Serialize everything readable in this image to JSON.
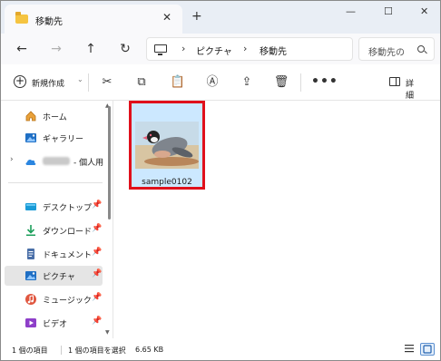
{
  "window": {
    "tab_title": "移動先",
    "close_tab_glyph": "✕",
    "new_tab_glyph": "+",
    "minimize_glyph": "—",
    "maximize_glyph": "☐",
    "close_glyph": "✕"
  },
  "nav": {
    "back_glyph": "←",
    "forward_glyph": "→",
    "up_glyph": "↑",
    "refresh_glyph": "↻",
    "breadcrumb": [
      "ピクチャ",
      "移動先"
    ],
    "crumb_sep": "›",
    "search_placeholder": "移動先の"
  },
  "toolbar": {
    "new_label": "新規作成",
    "new_chevron": "⌄",
    "cut_glyph": "✂",
    "copy_glyph": "⧉",
    "paste_glyph": "📋",
    "rename_glyph": "Ⓐ",
    "share_glyph": "⇪",
    "delete_glyph": "🗑",
    "more_glyph": "•••",
    "details_label": "詳細"
  },
  "sidebar": {
    "items": [
      {
        "label": "ホーム",
        "icon": "home-icon"
      },
      {
        "label": "ギャラリー",
        "icon": "gallery-icon"
      },
      {
        "label": "- 個人用",
        "icon": "onedrive-cloud-icon",
        "expander": "›",
        "blurred": true
      },
      {
        "label": "デスクトップ",
        "icon": "desktop-icon",
        "pin": "📌"
      },
      {
        "label": "ダウンロード",
        "icon": "download-icon",
        "pin": "📌"
      },
      {
        "label": "ドキュメント",
        "icon": "documents-icon",
        "pin": "📌"
      },
      {
        "label": "ピクチャ",
        "icon": "pictures-icon",
        "pin": "📌",
        "active": true
      },
      {
        "label": "ミュージック",
        "icon": "music-icon",
        "pin": "📌"
      },
      {
        "label": "ビデオ",
        "icon": "videos-icon",
        "pin": "📌"
      }
    ]
  },
  "content": {
    "files": [
      {
        "name": "sample0102",
        "type": "image-thumbnail",
        "selected": true
      }
    ]
  },
  "status": {
    "item_count": "1 個の項目",
    "selected": "1 個の項目を選択",
    "size": "6.65 KB"
  },
  "colors": {
    "selection_bg": "#cce8ff",
    "highlight_border": "#e0101b",
    "accent": "#0067c0"
  }
}
